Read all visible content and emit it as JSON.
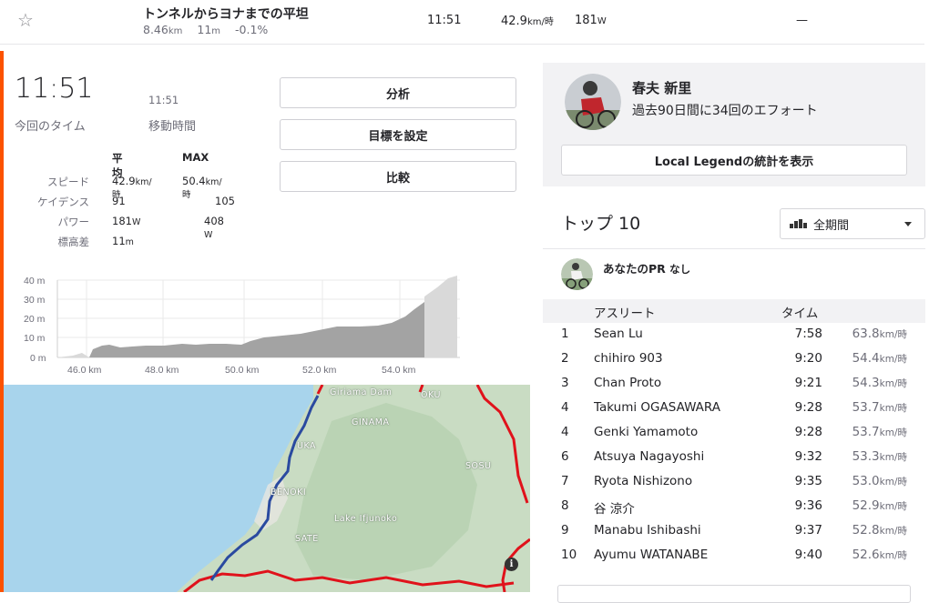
{
  "segment_row": {
    "name": "トンネルからヨナまでの平坦",
    "distance": "8.46",
    "distance_unit": "km",
    "elevation": "11",
    "elevation_unit": "m",
    "grade": "-0.1%",
    "time": "11:51",
    "speed": "42.9",
    "speed_unit": "km/時",
    "power": "181",
    "power_unit": "W",
    "extra": "—"
  },
  "effort": {
    "time": "11:51",
    "time_label": "今回のタイム",
    "moving_time": "11:51",
    "moving_label": "移動時間"
  },
  "buttons": {
    "analyze": "分析",
    "set_goal": "目標を設定",
    "compare": "比較"
  },
  "stats": {
    "col_avg": "平均",
    "col_max": "MAX",
    "rows": [
      {
        "label": "スピード",
        "avg": "42.9",
        "avg_unit": "km/時",
        "max": "50.4",
        "max_unit": "km/時"
      },
      {
        "label": "ケイデンス",
        "avg": "91",
        "avg_unit": "",
        "max": "105",
        "max_unit": ""
      },
      {
        "label": "パワー",
        "avg": "181",
        "avg_unit": "W",
        "max": "408",
        "max_unit": " W"
      },
      {
        "label": "標高差",
        "avg": "11",
        "avg_unit": "m",
        "max": "",
        "max_unit": ""
      }
    ]
  },
  "elevation_chart": {
    "y_ticks": [
      "40 m",
      "30 m",
      "20 m",
      "10 m",
      "0 m"
    ],
    "x_ticks": [
      "46.0 km",
      "48.0 km",
      "50.0 km",
      "52.0 km",
      "54.0 km"
    ],
    "colors": {
      "segment": "#a3a3a3",
      "outside": "#d9d9d9",
      "grid": "#eaeaea"
    }
  },
  "map": {
    "labels": [
      "Giriama Dam",
      "OKU",
      "GINAMA",
      "UKA",
      "SOSU",
      "BENOKI",
      "Lake Ifjunoko",
      "SATE"
    ],
    "info_icon": "i",
    "colors": {
      "route": "#e0121b",
      "segment": "#2a4aa0",
      "sea": "#a8d4ec",
      "land": "#c8dcc4"
    }
  },
  "local_legend": {
    "name": "春夫 新里",
    "subtitle": "過去90日間に34回のエフォート",
    "button": "Local Legendの統計を表示"
  },
  "leaderboard": {
    "title": "トップ 10",
    "period": "全期間",
    "pr_label": "あなたのPR",
    "pr_value": "なし",
    "col_athlete": "アスリート",
    "col_time": "タイム",
    "speed_unit": "km/時",
    "rows": [
      {
        "rank": "1",
        "athlete": "Sean Lu",
        "time": "7:58",
        "speed": "63.8"
      },
      {
        "rank": "2",
        "athlete": "chihiro 903",
        "time": "9:20",
        "speed": "54.4"
      },
      {
        "rank": "3",
        "athlete": "Chan Proto",
        "time": "9:21",
        "speed": "54.3"
      },
      {
        "rank": "4",
        "athlete": "Takumi OGASAWARA",
        "time": "9:28",
        "speed": "53.7"
      },
      {
        "rank": "4",
        "athlete": "Genki Yamamoto",
        "time": "9:28",
        "speed": "53.7"
      },
      {
        "rank": "6",
        "athlete": "Atsuya Nagayoshi",
        "time": "9:32",
        "speed": "53.3"
      },
      {
        "rank": "7",
        "athlete": "Ryota Nishizono",
        "time": "9:35",
        "speed": "53.0"
      },
      {
        "rank": "8",
        "athlete": "谷 涼介",
        "time": "9:36",
        "speed": "52.9"
      },
      {
        "rank": "9",
        "athlete": "Manabu Ishibashi",
        "time": "9:37",
        "speed": "52.8"
      },
      {
        "rank": "10",
        "athlete": "Ayumu WATANABE",
        "time": "9:40",
        "speed": "52.6"
      }
    ]
  },
  "accent_color": "#fc5200"
}
